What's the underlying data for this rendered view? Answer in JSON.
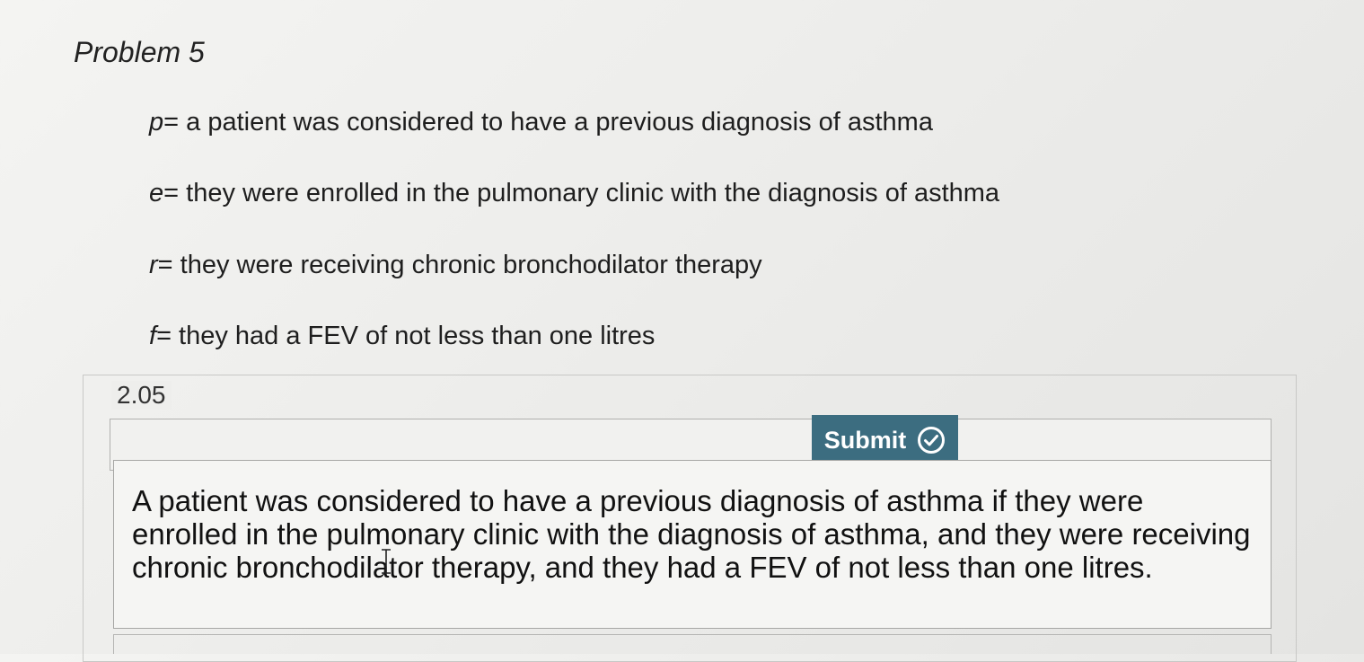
{
  "problem": {
    "title": "Problem 5"
  },
  "definitions": [
    {
      "var": "p",
      "text": "= a patient was considered to have a previous diagnosis of asthma"
    },
    {
      "var": "e",
      "text": "= they were enrolled in the pulmonary clinic with the diagnosis of asthma"
    },
    {
      "var": "r",
      "text": "= they were receiving chronic bronchodilator therapy"
    },
    {
      "var": "f",
      "text": "= they had a FEV of not less than one litres"
    }
  ],
  "question": {
    "number": "2.05",
    "submit_label": "Submit",
    "submit_icon": "check-circle-icon",
    "answer_text": "A patient was considered to have a previous diagnosis of asthma if they were enrolled in the pulmonary clinic with the diagnosis of asthma, and they were receiving chronic bronchodilator therapy, and they had a FEV of not less than one litres."
  },
  "colors": {
    "submit_bg": "#3c6d80",
    "submit_text": "#ffffff"
  }
}
